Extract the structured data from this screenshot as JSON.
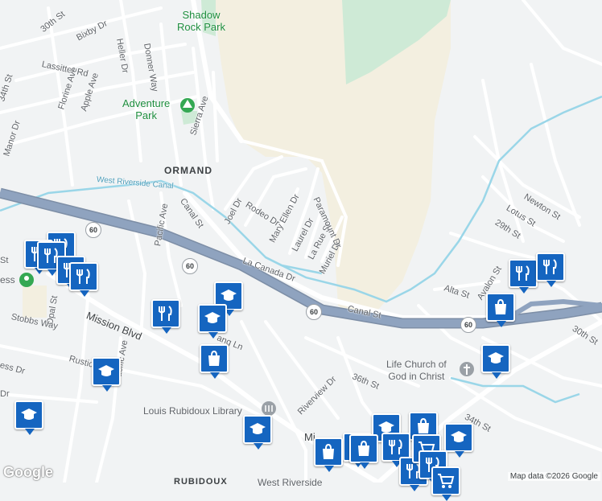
{
  "map": {
    "parks": {
      "shadow_rock": "Shadow\nRock Park",
      "adventure": "Adventure\nPark"
    },
    "neighborhood": "ORMAND",
    "canal": "West Riverside Canal",
    "route_number": "60",
    "poi": {
      "life_church": "Life Church of\nGod in Christ",
      "library": "Louis Rubidoux Library",
      "west_riverside": "West Riverside",
      "rubidoux": "RUBIDOUX",
      "express_partial": "ess"
    },
    "streets": {
      "s30th_nw": "30th St",
      "bixby": "Bixby Dr",
      "heller": "Heller Dr",
      "donner": "Donner Way",
      "lassitter": "Lassitter Rd",
      "florine": "Florine Ave",
      "apple": "Apple Ave",
      "s34th_w": "34th St",
      "manor": "Manor Dr",
      "sierra": "Sierra Ave",
      "joel": "Joel Dr",
      "rodeo": "Rodeo Dr",
      "mary_ellen": "Mary Ellen Dr",
      "laurel": "Laurel Dr",
      "la_rue": "La Rue St",
      "muriel": "Muriel Dr",
      "paramount": "Paramount Dr",
      "pacific_n": "Pacific Ave",
      "canal_st_w": "Canal St",
      "la_canada": "La Canada Dr",
      "canal_st_e": "Canal St",
      "opal": "Opal St",
      "stobbs": "Stobbs Way",
      "mission": "Mission Blvd",
      "rustic": "Rustic",
      "ess_dr": "ess Dr",
      "pacific_s": "Pacific Ave",
      "ang": "ang Ln",
      "riverview": "Riverview Dr",
      "s36th": "36th St",
      "s34th_e": "34th St",
      "newton": "Newton St",
      "lotus": "Lotus St",
      "s29th": "29th St",
      "alta": "Alta St",
      "avalon": "Avalon St",
      "s30th_e": "30th St",
      "mi": "Mi",
      "st_edge": "St",
      "dr_edge": "Dr"
    },
    "markers": [
      {
        "type": "restaurant"
      },
      {
        "type": "restaurant"
      },
      {
        "type": "restaurant"
      },
      {
        "type": "restaurant"
      },
      {
        "type": "restaurant"
      },
      {
        "type": "school"
      },
      {
        "type": "restaurant"
      },
      {
        "type": "school"
      },
      {
        "type": "shopping"
      },
      {
        "type": "school"
      },
      {
        "type": "school"
      },
      {
        "type": "school"
      },
      {
        "type": "restaurant"
      },
      {
        "type": "restaurant"
      },
      {
        "type": "shopping"
      },
      {
        "type": "school"
      },
      {
        "type": "school"
      },
      {
        "type": "school"
      },
      {
        "type": "shopping"
      },
      {
        "type": "school"
      },
      {
        "type": "shopping"
      },
      {
        "type": "shopping"
      },
      {
        "type": "restaurant"
      },
      {
        "type": "restaurant"
      },
      {
        "type": "grocery"
      },
      {
        "type": "restaurant"
      },
      {
        "type": "grocery"
      }
    ],
    "attribution": "Map data ©2026 Google",
    "logo": "Google",
    "colors": {
      "marker": "#1565c0",
      "park": "#ceead6",
      "open_land": "#f3efe0",
      "freeway": "#8fa3bf",
      "water": "#9ad6e8"
    }
  }
}
